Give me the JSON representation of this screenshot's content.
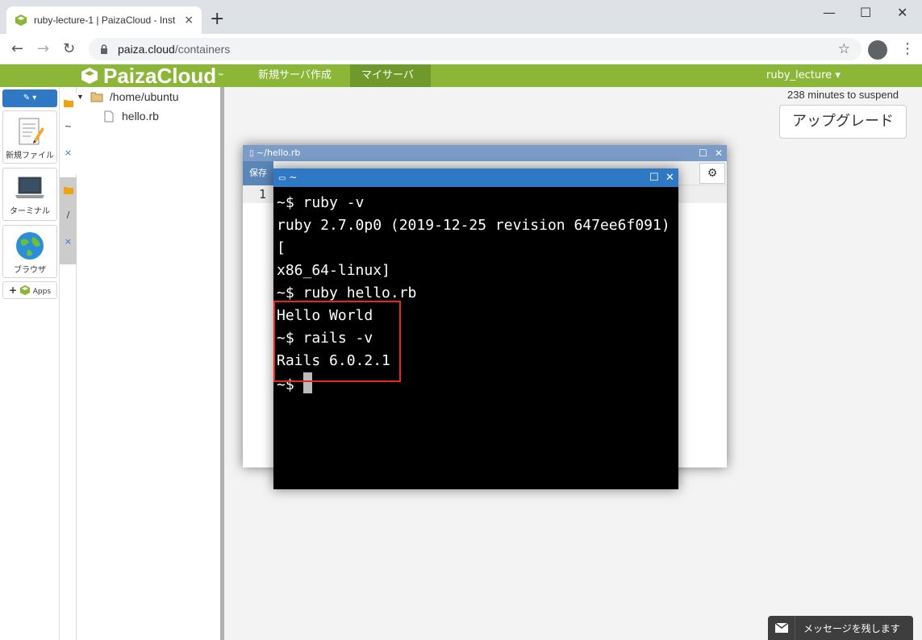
{
  "browser": {
    "tab_title": "ruby-lecture-1 | PaizaCloud - Inst",
    "close_tab": "×",
    "new_tab": "+",
    "url_host": "paiza.cloud",
    "url_path": "/containers",
    "window_controls": [
      "—",
      "☐",
      "✕"
    ]
  },
  "app": {
    "brand": "PaizaCloud",
    "brand_tm": "™",
    "menu_new_server": "新規サーバ作成",
    "menu_my_server": "マイサーバ",
    "user": "ruby_lecture ▾",
    "suspend_text": "238 minutes to suspend",
    "upgrade_label": "アップグレード",
    "message_label": "メッセージを残します"
  },
  "sidebar": {
    "buttons": [
      {
        "label": "新規ファイル",
        "icon": "document-edit-icon"
      },
      {
        "label": "ターミナル",
        "icon": "laptop-icon"
      },
      {
        "label": "ブラウザ",
        "icon": "globe-icon"
      }
    ],
    "apps_label": "Apps"
  },
  "vtabs": {
    "tab1_label": "~",
    "tab2_label": "/",
    "close_label": "×"
  },
  "filetree": {
    "root": "/home/ubuntu",
    "files": [
      "hello.rb"
    ]
  },
  "editor": {
    "title": "~/hello.rb",
    "save_label": "保存",
    "line_number": "1"
  },
  "terminal": {
    "title": "~",
    "lines": [
      "~$ ruby -v",
      "ruby 2.7.0p0 (2019-12-25 revision 647ee6f091) [",
      "x86_64-linux]",
      "~$ ruby hello.rb",
      "Hello World",
      "~$ rails -v",
      "Rails 6.0.2.1"
    ],
    "prompt": "~$ "
  },
  "colors": {
    "app_bar": "#8bb637",
    "highlight": "#e8281e",
    "terminal_title": "#2f78c4"
  }
}
